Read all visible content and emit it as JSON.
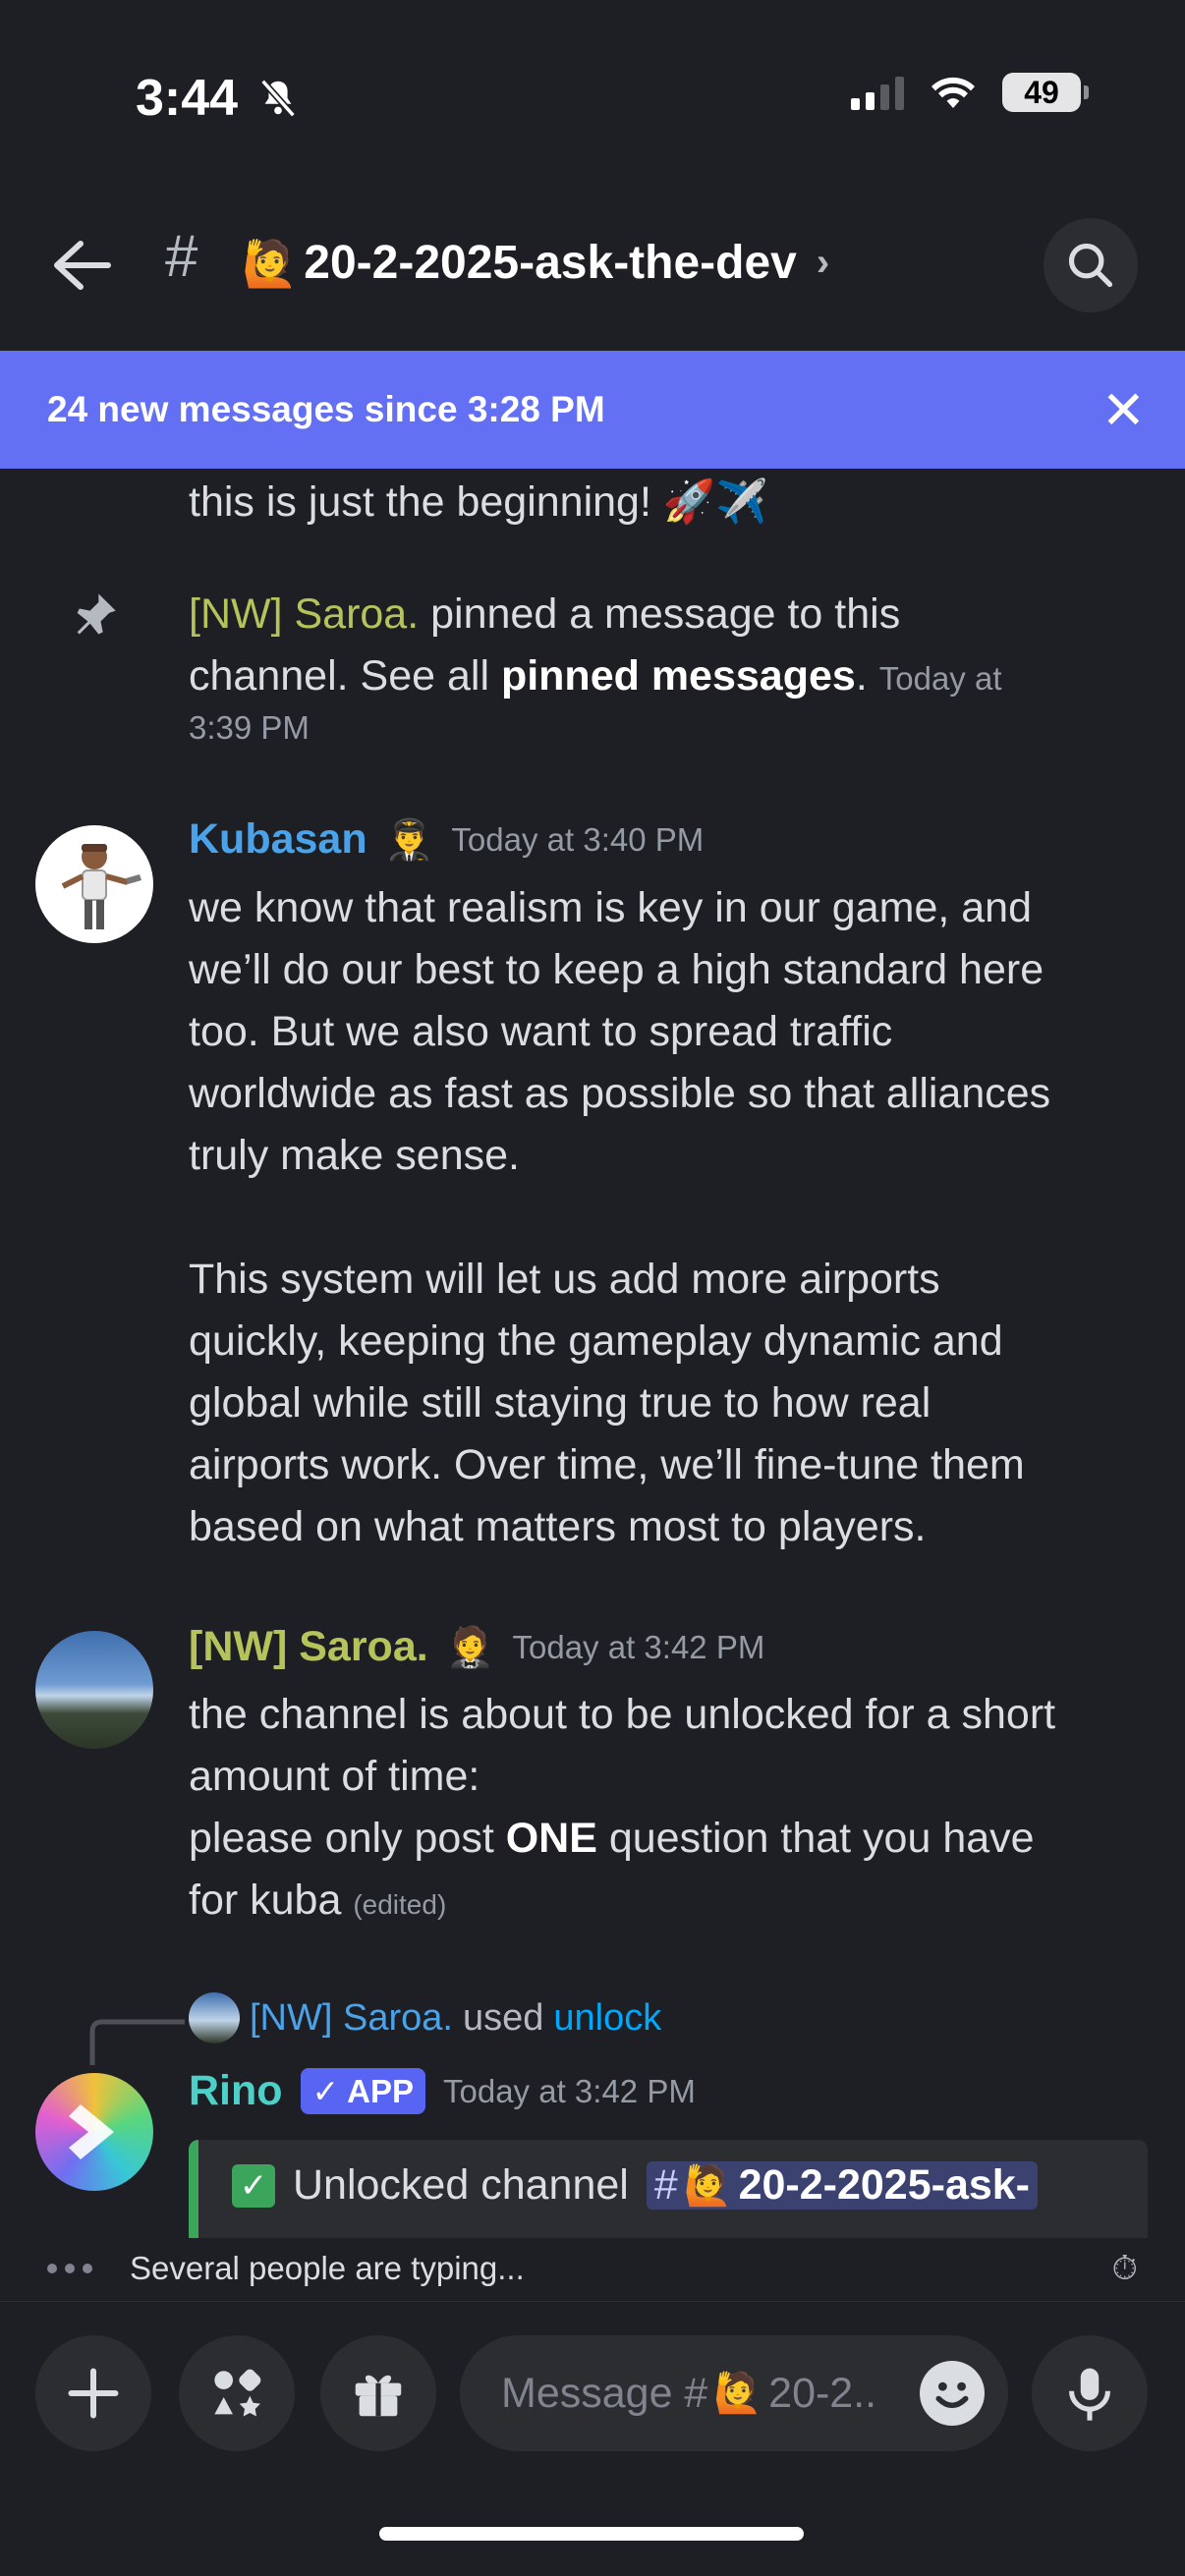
{
  "status_bar": {
    "time": "3:44",
    "battery": "49"
  },
  "header": {
    "hash": "#",
    "channel_emoji": "🙋",
    "channel_name": "20-2-2025-ask-the-dev",
    "chevron": "›"
  },
  "banner": {
    "text": "24 new messages since 3:28 PM",
    "close": "✕"
  },
  "messages": {
    "prev_tail": "this is just the beginning! 🚀✈️",
    "pin_notice": {
      "author": "[NW] Saroa.",
      "text1": " pinned a message to this channel. See all ",
      "link": "pinned messages",
      "text2": ". ",
      "timestamp_line1": "Today at",
      "timestamp_line2": "3:39 PM"
    },
    "kubasan": {
      "author": "Kubasan",
      "badge_emoji": "👨‍✈️",
      "timestamp": "Today at 3:40 PM",
      "para1_lines": [
        "we know that realism is key in our game, and",
        "we’ll do our best to keep a high standard here",
        "too. But we also want to spread traffic",
        "worldwide as fast as possible so that alliances",
        "truly make sense."
      ],
      "para2_lines": [
        "This system will let us add more airports",
        "quickly, keeping the gameplay dynamic and",
        "global while still staying true to how real",
        "airports work. Over time, we’ll fine-tune them",
        "based on what matters most to players."
      ]
    },
    "saroa": {
      "author": "[NW] Saroa.",
      "badge_emoji": "🤵",
      "timestamp": "Today at 3:42 PM",
      "line1": "the channel is about to be unlocked for a short",
      "line2": "amount of time:",
      "line3_pre": "please only post ",
      "line3_bold": "ONE",
      "line3_post": " question that you have",
      "line4": "for kuba",
      "edited": "(edited)"
    },
    "reply": {
      "author": "[NW] Saroa.",
      "used": " used ",
      "command": "unlock"
    },
    "rino": {
      "author": "Rino",
      "badge": "✓ APP",
      "timestamp": "Today at 3:42 PM",
      "embed_text": "Unlocked channel",
      "mention_hash": "#",
      "mention_emoji": "🙋",
      "mention_name": "20-2-2025-ask-"
    }
  },
  "typing": {
    "text": "Several people are typing..."
  },
  "composer": {
    "placeholder_prefix": "Message #",
    "placeholder_emoji": "🙋",
    "placeholder_suffix": "20-2.."
  },
  "colors": {
    "banner": "#6470f3",
    "kubasan_name": "#4aa3e8",
    "saroa_name": "#b6c35a",
    "rino_name": "#4dd0c8",
    "link": "#00a8fc"
  }
}
